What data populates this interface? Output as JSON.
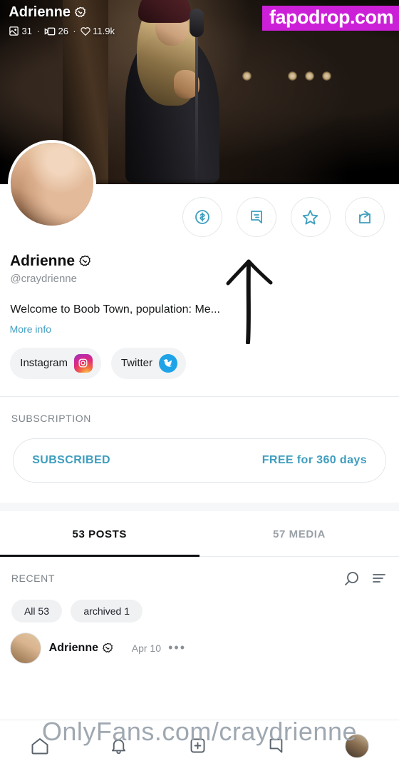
{
  "watermarks": {
    "site_badge": "fapodrop.com",
    "url_overlay": "OnlyFans.com/craydrienne"
  },
  "banner": {
    "back_icon": "arrow-back-icon",
    "display_name": "Adrienne",
    "verified_icon": "verified-badge-icon",
    "stats": {
      "photos": "31",
      "photos_icon": "photo-icon",
      "videos": "26",
      "videos_icon": "video-icon",
      "likes": "11.9k",
      "likes_icon": "heart-icon",
      "separator": "·"
    }
  },
  "actions": [
    {
      "name": "share-button",
      "icon": "share-icon"
    },
    {
      "name": "favorite-button",
      "icon": "star-icon"
    },
    {
      "name": "message-button",
      "icon": "chat-icon"
    },
    {
      "name": "tip-button",
      "icon": "dollar-circle-icon"
    }
  ],
  "profile": {
    "display_name": "Adrienne",
    "verified_icon": "verified-badge-icon",
    "handle": "@craydrienne",
    "bio": "Welcome to Boob Town, population: Me...",
    "more_info": "More info",
    "avatar_name": "profile-avatar"
  },
  "socials": [
    {
      "name": "instagram-link",
      "label": "Instagram",
      "icon": "instagram-icon",
      "color": "#e42b73"
    },
    {
      "name": "twitter-link",
      "label": "Twitter",
      "icon": "twitter-icon",
      "color": "#1fa3e8"
    }
  ],
  "subscription": {
    "section_title": "SUBSCRIPTION",
    "status_label": "SUBSCRIBED",
    "price_label": "FREE for 360 days",
    "accent_color": "#3e9dbe"
  },
  "tabs": [
    {
      "name": "tab-posts",
      "label": "53 POSTS",
      "active": true
    },
    {
      "name": "tab-media",
      "label": "57 MEDIA",
      "active": false
    }
  ],
  "filters": {
    "recent_label": "RECENT",
    "search_icon": "search-icon",
    "sort_icon": "filter-sort-icon",
    "chips": [
      {
        "name": "chip-all",
        "label": "All 53"
      },
      {
        "name": "chip-archived",
        "label": "archived 1"
      }
    ]
  },
  "post": {
    "author": "Adrienne",
    "verified_icon": "verified-badge-icon",
    "date": "Apr 10",
    "more_label": "•••"
  },
  "bottom_nav": [
    {
      "name": "nav-home",
      "icon": "home-icon"
    },
    {
      "name": "nav-notifications",
      "icon": "bell-icon"
    },
    {
      "name": "nav-new-post",
      "icon": "plus-square-icon"
    },
    {
      "name": "nav-messages",
      "icon": "message-icon"
    },
    {
      "name": "nav-profile",
      "icon": "avatar-icon"
    }
  ],
  "annotation": {
    "name": "hand-drawn-arrow",
    "icon": "arrow-up-annotation"
  }
}
